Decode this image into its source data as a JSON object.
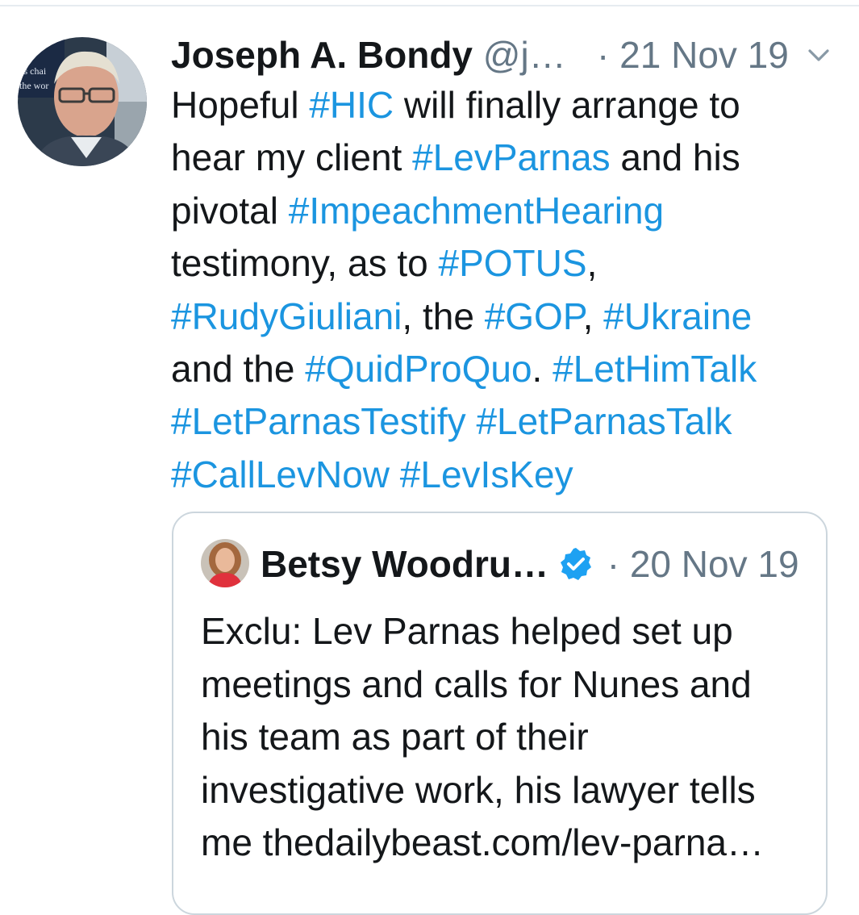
{
  "tweet": {
    "author_name": "Joseph A. Bondy",
    "author_handle": "@j…",
    "separator": "·",
    "date": "21 Nov 19",
    "more_icon": "chevron-down-icon",
    "lines": [
      [
        {
          "t": "Hopeful "
        },
        {
          "t": "#HIC",
          "tag": true
        },
        {
          "t": " will finally arrange to"
        }
      ],
      [
        {
          "t": "hear my client "
        },
        {
          "t": "#LevParnas",
          "tag": true
        },
        {
          "t": " and his"
        }
      ],
      [
        {
          "t": "pivotal "
        },
        {
          "t": "#ImpeachmentHearing",
          "tag": true
        }
      ],
      [
        {
          "t": "testimony, as to "
        },
        {
          "t": "#POTUS",
          "tag": true
        },
        {
          "t": ","
        }
      ],
      [
        {
          "t": "#RudyGiuliani",
          "tag": true
        },
        {
          "t": ", the "
        },
        {
          "t": "#GOP",
          "tag": true
        },
        {
          "t": ", "
        },
        {
          "t": "#Ukraine",
          "tag": true
        }
      ],
      [
        {
          "t": "and the "
        },
        {
          "t": "#QuidProQuo",
          "tag": true
        },
        {
          "t": ". "
        },
        {
          "t": "#LetHimTalk",
          "tag": true
        }
      ],
      [
        {
          "t": "#LetParnasTestify",
          "tag": true
        },
        {
          "t": " "
        },
        {
          "t": "#LetParnasTalk",
          "tag": true
        }
      ],
      [
        {
          "t": "#CallLevNow",
          "tag": true
        },
        {
          "t": " "
        },
        {
          "t": "#LevIsKey",
          "tag": true
        }
      ]
    ]
  },
  "quoted_tweet": {
    "author_name": "Betsy Woodru…",
    "verified_icon": "verified-badge-icon",
    "separator": "·",
    "date": "20 Nov 19",
    "lines": [
      "Exclu: Lev Parnas helped set up",
      "meetings and calls for Nunes and",
      "his team as part of their",
      "investigative work, his lawyer tells",
      "me thedailybeast.com/lev-parna…"
    ]
  },
  "colors": {
    "hashtag": "#1b95e0",
    "secondary_text": "#657786",
    "verified": "#1da1f2",
    "border": "#ccd6dd"
  }
}
